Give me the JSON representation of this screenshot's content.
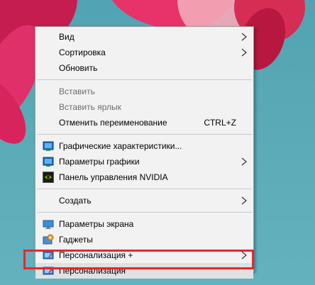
{
  "menu": {
    "items": [
      {
        "label": "Вид",
        "submenu": true
      },
      {
        "label": "Сортировка",
        "submenu": true
      },
      {
        "label": "Обновить"
      },
      {
        "label": "Вставить",
        "disabled": true
      },
      {
        "label": "Вставить ярлык",
        "disabled": true
      },
      {
        "label": "Отменить переименование",
        "shortcut": "CTRL+Z"
      },
      {
        "label": "Графические характеристики...",
        "icon": "intel-graphics-icon"
      },
      {
        "label": "Параметры графики",
        "icon": "intel-graphics-icon",
        "submenu": true
      },
      {
        "label": "Панель управления NVIDIA",
        "icon": "nvidia-icon"
      },
      {
        "label": "Создать",
        "submenu": true
      },
      {
        "label": "Параметры экрана",
        "icon": "display-icon"
      },
      {
        "label": "Гаджеты",
        "icon": "gadgets-icon"
      },
      {
        "label": "Персонализация +",
        "icon": "personalization-icon",
        "submenu": true
      },
      {
        "label": "Персонализация",
        "icon": "personalization-icon",
        "highlighted": true
      }
    ]
  },
  "colors": {
    "menu_bg": "#f2f2f2",
    "highlight_box": "#e8262e",
    "disabled_text": "#6d6d6d"
  }
}
